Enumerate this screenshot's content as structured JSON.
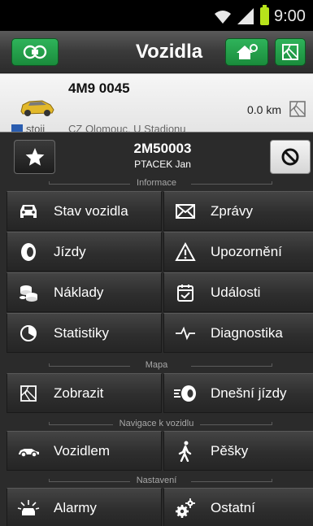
{
  "status_bar": {
    "time": "9:00"
  },
  "header": {
    "title": "Vozidla"
  },
  "vehicle": {
    "plate": "4M9 0045",
    "distance": "0.0 km",
    "status": "stoji",
    "location": "CZ Olomouc, U Stadionu"
  },
  "panel": {
    "plate": "2M50003",
    "driver": "PTACEK Jan",
    "sections": {
      "info": "Informace",
      "map": "Mapa",
      "navigation": "Navigace k vozidlu",
      "settings": "Nastavení"
    },
    "buttons": {
      "state": "Stav vozidla",
      "messages": "Zprávy",
      "trips": "Jízdy",
      "warnings": "Upozornění",
      "costs": "Náklady",
      "events": "Události",
      "stats": "Statistiky",
      "diagnostics": "Diagnostika",
      "show": "Zobrazit",
      "today_trips": "Dnešní jízdy",
      "by_vehicle": "Vozidlem",
      "on_foot": "Pěšky",
      "alarms": "Alarmy",
      "other": "Ostatní"
    }
  },
  "colors": {
    "accent_green": "#1f9a45",
    "panel_bg": "#2b2b2b",
    "battery": "#b7e31b"
  },
  "icons": {
    "status": [
      "wifi-icon",
      "signal-icon",
      "battery-icon"
    ],
    "header": [
      "menu-icon",
      "home-search-icon",
      "map-icon"
    ],
    "panel": [
      "star-icon",
      "block-icon"
    ]
  }
}
